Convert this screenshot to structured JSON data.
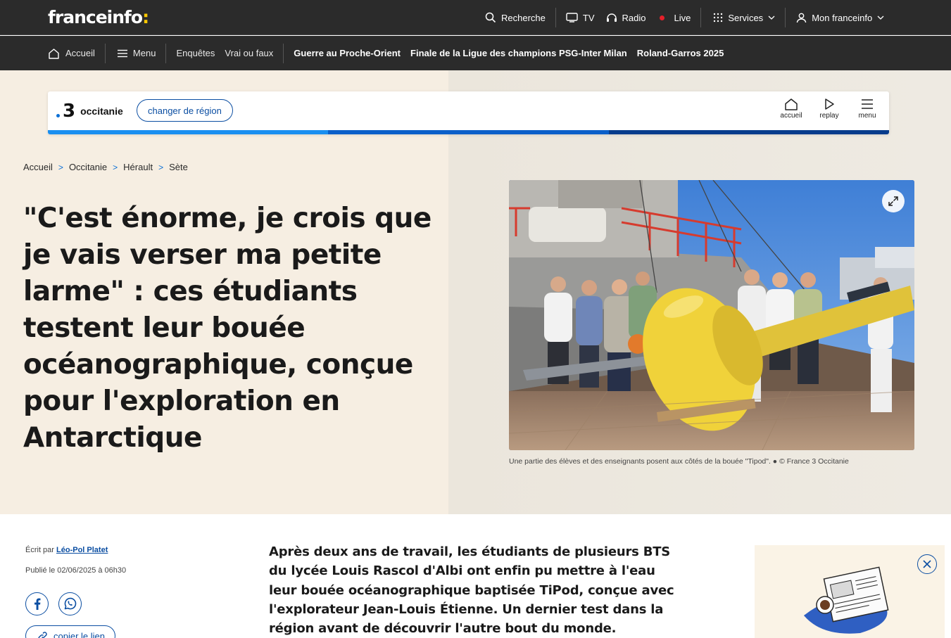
{
  "header": {
    "logo_text": "franceinfo",
    "logo_colon": ":",
    "nav": {
      "search": "Recherche",
      "tv": "TV",
      "radio": "Radio",
      "live": "Live",
      "services": "Services",
      "account": "Mon franceinfo"
    }
  },
  "subnav": {
    "home": "Accueil",
    "menu": "Menu",
    "investigations": "Enquêtes",
    "fact_check": "Vrai ou faux",
    "topics": [
      "Guerre au Proche-Orient",
      "Finale de la Ligue des champions PSG-Inter Milan",
      "Roland-Garros 2025"
    ]
  },
  "region_bar": {
    "channel_number": "3",
    "region_name": "occitanie",
    "change_region": "changer de région",
    "actions": {
      "home": "accueil",
      "replay": "replay",
      "menu": "menu"
    },
    "stripe_colors": [
      "#1a8ff0",
      "#0b5fc9",
      "#073c8c"
    ]
  },
  "breadcrumb": [
    "Accueil",
    "Occitanie",
    "Hérault",
    "Sète"
  ],
  "article": {
    "title": "\"C'est énorme, je crois que je vais verser ma petite larme\" : ces étudiants testent leur bouée océanographique, conçue pour l'exploration en Antarctique",
    "photo_caption": "Une partie des élèves et des enseignants posent aux côtés de la bouée \"Tipod\". ● © France 3 Occitanie",
    "written_by_label": "Écrit par",
    "author": "Léo-Pol Platet",
    "published": "Publié le 02/06/2025 à 06h30",
    "copy_link": "copier le lien",
    "lead": "Après deux ans de travail, les étudiants de plusieurs BTS du lycée Louis Rascol d'Albi ont enfin pu mettre à l'eau leur bouée océanographique baptisée TiPod, conçue avec l'explorateur Jean-Louis Étienne. Un dernier test dans la région avant de découvrir l'autre bout du monde."
  },
  "colors": {
    "header_bg": "#2b2b2b",
    "accent_blue": "#0b4ea2",
    "live_red": "#e5202a",
    "logo_yellow": "#ffc900",
    "hero_bg": "#f6eee2"
  }
}
